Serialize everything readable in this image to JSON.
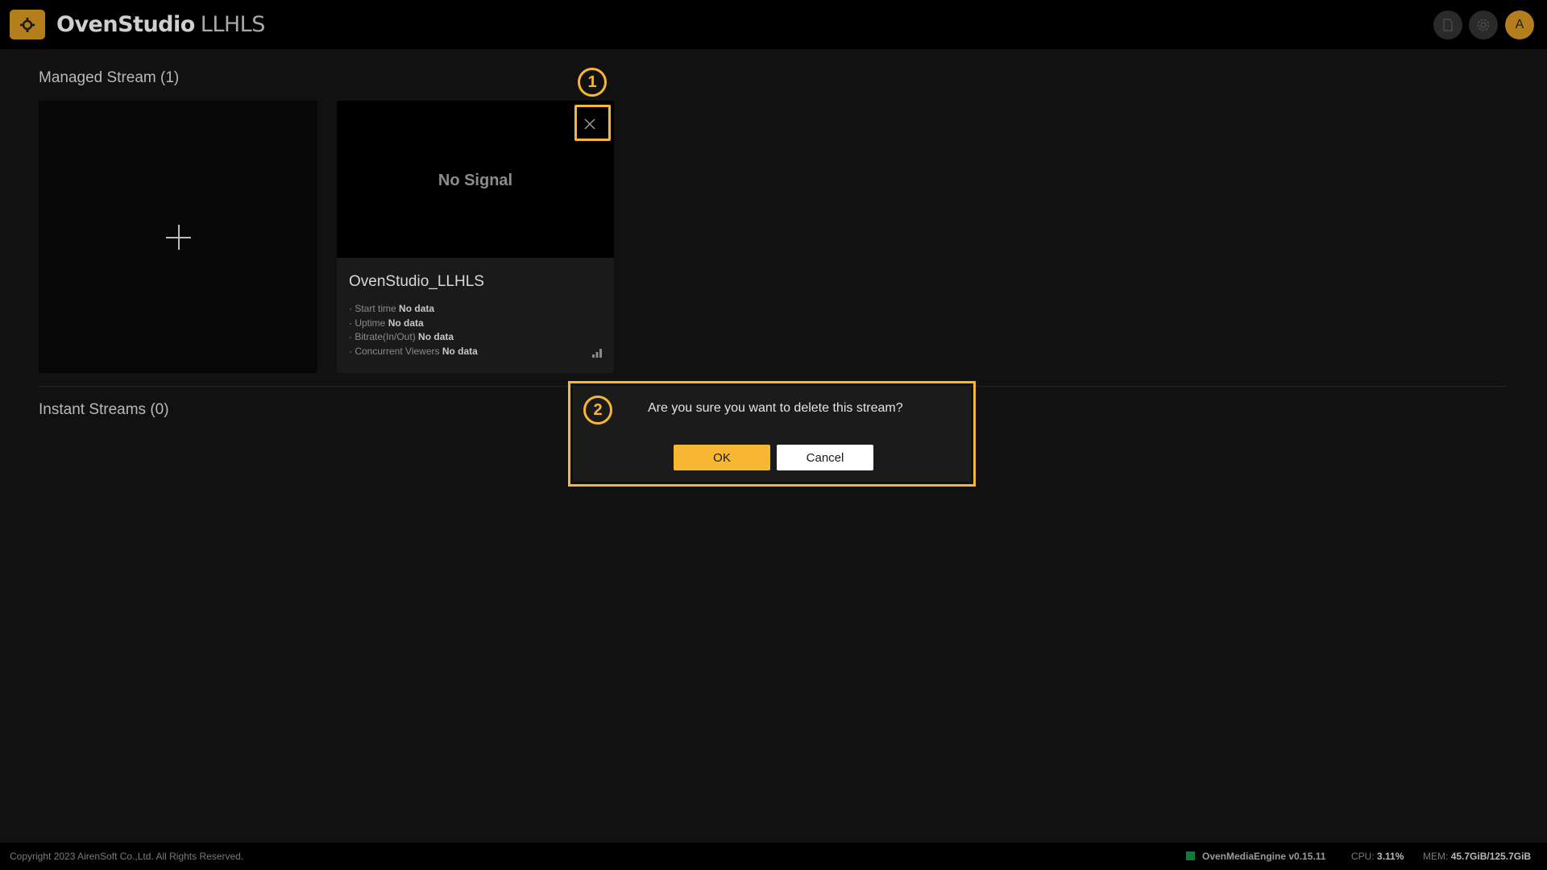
{
  "header": {
    "brand_main": "OvenStudio",
    "brand_sub": "LLHLS",
    "avatar_letter": "A"
  },
  "managed": {
    "title": "Managed Stream (1)",
    "stream": {
      "preview_text": "No Signal",
      "name": "OvenStudio_LLHLS",
      "stats": [
        {
          "label": "· Start time",
          "value": "No data"
        },
        {
          "label": "· Uptime",
          "value": "No data"
        },
        {
          "label": "· Bitrate(In/Out)",
          "value": "No data"
        },
        {
          "label": "· Concurrent Viewers",
          "value": "No data"
        }
      ]
    }
  },
  "instant": {
    "title": "Instant Streams (0)"
  },
  "annotations": {
    "one": "1",
    "two": "2"
  },
  "dialog": {
    "message": "Are you sure you want to delete this stream?",
    "ok_label": "OK",
    "cancel_label": "Cancel"
  },
  "footer": {
    "copyright": "Copyright 2023 AirenSoft Co.,Ltd. All Rights Reserved.",
    "engine": "OvenMediaEngine v0.15.11",
    "cpu_label": "CPU:",
    "cpu_value": "3.11%",
    "mem_label": "MEM:",
    "mem_value": "45.7GiB/125.7GiB"
  },
  "colors": {
    "accent": "#f7b733",
    "brand": "#b47e1c",
    "status_ok": "#0f7a3c"
  }
}
